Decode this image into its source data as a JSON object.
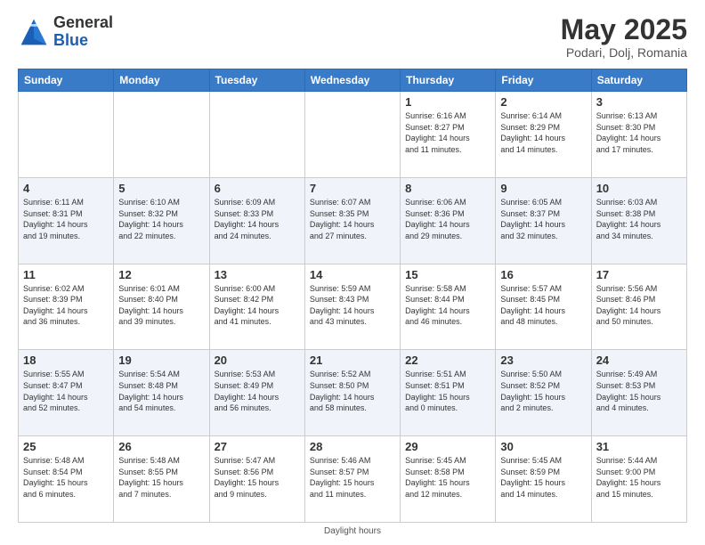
{
  "header": {
    "logo_general": "General",
    "logo_blue": "Blue",
    "month_title": "May 2025",
    "location": "Podari, Dolj, Romania"
  },
  "weekdays": [
    "Sunday",
    "Monday",
    "Tuesday",
    "Wednesday",
    "Thursday",
    "Friday",
    "Saturday"
  ],
  "footer": {
    "note": "Daylight hours"
  },
  "weeks": [
    [
      {
        "day": "",
        "info": ""
      },
      {
        "day": "",
        "info": ""
      },
      {
        "day": "",
        "info": ""
      },
      {
        "day": "",
        "info": ""
      },
      {
        "day": "1",
        "info": "Sunrise: 6:16 AM\nSunset: 8:27 PM\nDaylight: 14 hours\nand 11 minutes."
      },
      {
        "day": "2",
        "info": "Sunrise: 6:14 AM\nSunset: 8:29 PM\nDaylight: 14 hours\nand 14 minutes."
      },
      {
        "day": "3",
        "info": "Sunrise: 6:13 AM\nSunset: 8:30 PM\nDaylight: 14 hours\nand 17 minutes."
      }
    ],
    [
      {
        "day": "4",
        "info": "Sunrise: 6:11 AM\nSunset: 8:31 PM\nDaylight: 14 hours\nand 19 minutes."
      },
      {
        "day": "5",
        "info": "Sunrise: 6:10 AM\nSunset: 8:32 PM\nDaylight: 14 hours\nand 22 minutes."
      },
      {
        "day": "6",
        "info": "Sunrise: 6:09 AM\nSunset: 8:33 PM\nDaylight: 14 hours\nand 24 minutes."
      },
      {
        "day": "7",
        "info": "Sunrise: 6:07 AM\nSunset: 8:35 PM\nDaylight: 14 hours\nand 27 minutes."
      },
      {
        "day": "8",
        "info": "Sunrise: 6:06 AM\nSunset: 8:36 PM\nDaylight: 14 hours\nand 29 minutes."
      },
      {
        "day": "9",
        "info": "Sunrise: 6:05 AM\nSunset: 8:37 PM\nDaylight: 14 hours\nand 32 minutes."
      },
      {
        "day": "10",
        "info": "Sunrise: 6:03 AM\nSunset: 8:38 PM\nDaylight: 14 hours\nand 34 minutes."
      }
    ],
    [
      {
        "day": "11",
        "info": "Sunrise: 6:02 AM\nSunset: 8:39 PM\nDaylight: 14 hours\nand 36 minutes."
      },
      {
        "day": "12",
        "info": "Sunrise: 6:01 AM\nSunset: 8:40 PM\nDaylight: 14 hours\nand 39 minutes."
      },
      {
        "day": "13",
        "info": "Sunrise: 6:00 AM\nSunset: 8:42 PM\nDaylight: 14 hours\nand 41 minutes."
      },
      {
        "day": "14",
        "info": "Sunrise: 5:59 AM\nSunset: 8:43 PM\nDaylight: 14 hours\nand 43 minutes."
      },
      {
        "day": "15",
        "info": "Sunrise: 5:58 AM\nSunset: 8:44 PM\nDaylight: 14 hours\nand 46 minutes."
      },
      {
        "day": "16",
        "info": "Sunrise: 5:57 AM\nSunset: 8:45 PM\nDaylight: 14 hours\nand 48 minutes."
      },
      {
        "day": "17",
        "info": "Sunrise: 5:56 AM\nSunset: 8:46 PM\nDaylight: 14 hours\nand 50 minutes."
      }
    ],
    [
      {
        "day": "18",
        "info": "Sunrise: 5:55 AM\nSunset: 8:47 PM\nDaylight: 14 hours\nand 52 minutes."
      },
      {
        "day": "19",
        "info": "Sunrise: 5:54 AM\nSunset: 8:48 PM\nDaylight: 14 hours\nand 54 minutes."
      },
      {
        "day": "20",
        "info": "Sunrise: 5:53 AM\nSunset: 8:49 PM\nDaylight: 14 hours\nand 56 minutes."
      },
      {
        "day": "21",
        "info": "Sunrise: 5:52 AM\nSunset: 8:50 PM\nDaylight: 14 hours\nand 58 minutes."
      },
      {
        "day": "22",
        "info": "Sunrise: 5:51 AM\nSunset: 8:51 PM\nDaylight: 15 hours\nand 0 minutes."
      },
      {
        "day": "23",
        "info": "Sunrise: 5:50 AM\nSunset: 8:52 PM\nDaylight: 15 hours\nand 2 minutes."
      },
      {
        "day": "24",
        "info": "Sunrise: 5:49 AM\nSunset: 8:53 PM\nDaylight: 15 hours\nand 4 minutes."
      }
    ],
    [
      {
        "day": "25",
        "info": "Sunrise: 5:48 AM\nSunset: 8:54 PM\nDaylight: 15 hours\nand 6 minutes."
      },
      {
        "day": "26",
        "info": "Sunrise: 5:48 AM\nSunset: 8:55 PM\nDaylight: 15 hours\nand 7 minutes."
      },
      {
        "day": "27",
        "info": "Sunrise: 5:47 AM\nSunset: 8:56 PM\nDaylight: 15 hours\nand 9 minutes."
      },
      {
        "day": "28",
        "info": "Sunrise: 5:46 AM\nSunset: 8:57 PM\nDaylight: 15 hours\nand 11 minutes."
      },
      {
        "day": "29",
        "info": "Sunrise: 5:45 AM\nSunset: 8:58 PM\nDaylight: 15 hours\nand 12 minutes."
      },
      {
        "day": "30",
        "info": "Sunrise: 5:45 AM\nSunset: 8:59 PM\nDaylight: 15 hours\nand 14 minutes."
      },
      {
        "day": "31",
        "info": "Sunrise: 5:44 AM\nSunset: 9:00 PM\nDaylight: 15 hours\nand 15 minutes."
      }
    ]
  ]
}
